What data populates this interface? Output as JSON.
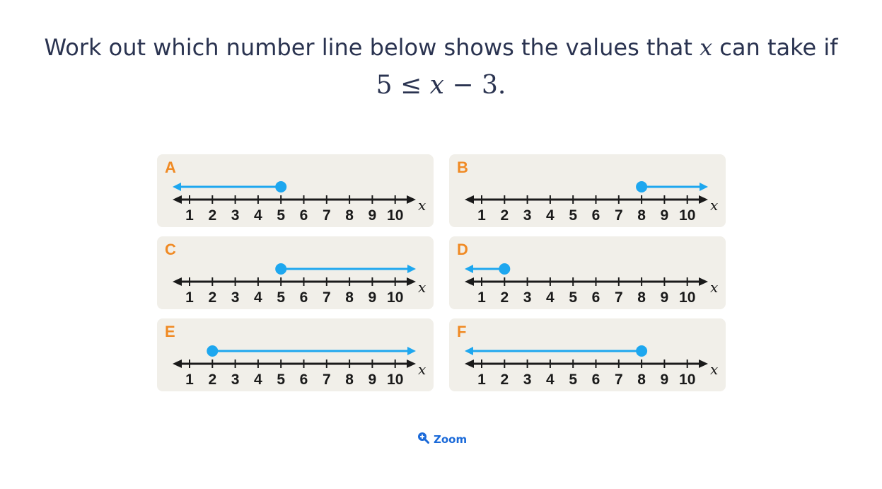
{
  "question": {
    "text": "Work out which number line below shows the values that",
    "variable": "x",
    "text_after": "can take if",
    "inequality": {
      "left": "5 ≤ ",
      "var": "x",
      "right": " − 3."
    }
  },
  "options": [
    {
      "letter": "A",
      "point": 5,
      "direction": "left"
    },
    {
      "letter": "B",
      "point": 8,
      "direction": "right"
    },
    {
      "letter": "C",
      "point": 5,
      "direction": "right"
    },
    {
      "letter": "D",
      "point": 2,
      "direction": "left"
    },
    {
      "letter": "E",
      "point": 2,
      "direction": "right"
    },
    {
      "letter": "F",
      "point": 8,
      "direction": "left"
    }
  ],
  "number_line": {
    "ticks": [
      "1",
      "2",
      "3",
      "4",
      "5",
      "6",
      "7",
      "8",
      "9",
      "10"
    ],
    "axis_label": "x",
    "colors": {
      "axis": "#1a1a1a",
      "ray": "#1ea7ef",
      "panel": "#f1efe9",
      "letter": "#f08a24"
    }
  },
  "zoom": {
    "label": "Zoom",
    "icon": "zoom-in-icon"
  }
}
